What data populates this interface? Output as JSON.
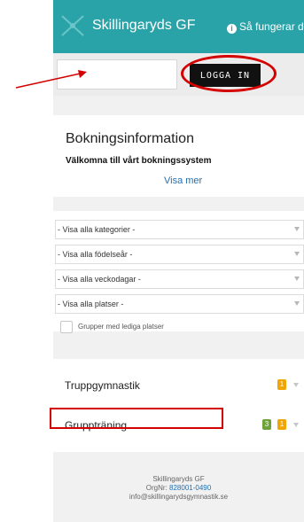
{
  "header": {
    "brand": "Skillingaryds GF",
    "howto": "Så fungerar de",
    "brand_color": "#2aa3a8"
  },
  "login": {
    "input_value": "",
    "button_label": "LOGGA IN"
  },
  "booking_info": {
    "title": "Bokningsinformation",
    "subtitle": "Välkomna till vårt bokningssystem",
    "link": "Visa mer"
  },
  "filters": {
    "options": [
      "- Visa alla kategorier -",
      "- Visa alla födelseår -",
      "- Visa alla veckodagar -",
      "- Visa alla platser -"
    ],
    "checkbox_label": "Grupper med lediga platser"
  },
  "groups": [
    {
      "name": "Truppgymnastik",
      "badges": [
        "1"
      ]
    },
    {
      "name": "Gruppträning",
      "badges": [
        "3",
        "1"
      ]
    }
  ],
  "footer": {
    "name": "Skillingaryds GF",
    "orgnr_label": "OrgNr:",
    "orgnr_value": "828001-0490",
    "email": "info@skillingarydsgymnastik.se"
  }
}
